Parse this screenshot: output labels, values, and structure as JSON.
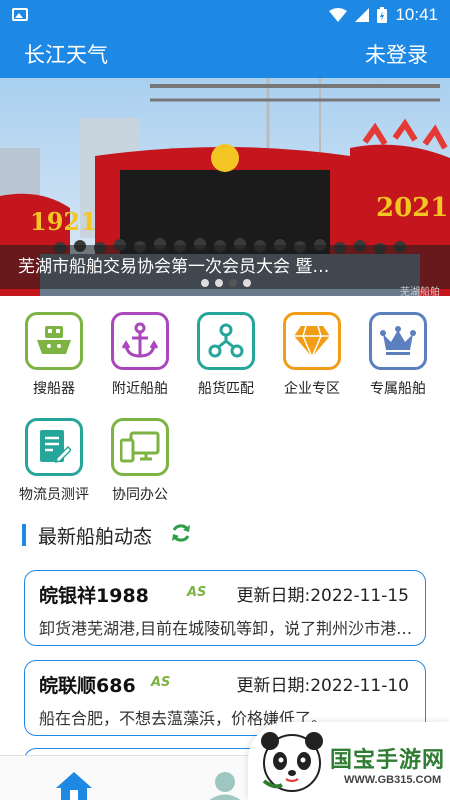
{
  "status_bar": {
    "time": "10:41",
    "icons": [
      "image-icon",
      "wifi-icon",
      "signal-icon",
      "battery-charging-icon"
    ]
  },
  "app_bar": {
    "title": "长江天气",
    "login_label": "未登录"
  },
  "banner": {
    "caption": "芜湖市船舶交易协会第一次会员大会 暨…",
    "years": [
      "1921",
      "2021"
    ],
    "watermark": "芜湖船舶",
    "slide_count": 4,
    "active_slide": 2
  },
  "features": [
    {
      "label": "搜船器",
      "icon": "ship-icon",
      "color": "#7cb342"
    },
    {
      "label": "附近船舶",
      "icon": "anchor-icon",
      "color": "#ab47bc"
    },
    {
      "label": "船货匹配",
      "icon": "network-nodes-icon",
      "color": "#26a69a"
    },
    {
      "label": "企业专区",
      "icon": "diamond-icon",
      "color": "#f29d16"
    },
    {
      "label": "专属船舶",
      "icon": "crown-icon",
      "color": "#5c7fbf"
    },
    {
      "label": "物流员测评",
      "icon": "document-edit-icon",
      "color": "#26a69a"
    },
    {
      "label": "协同办公",
      "icon": "devices-icon",
      "color": "#7cb342"
    }
  ],
  "section": {
    "title": "最新船舶动态",
    "refresh_icon": "refresh-icon"
  },
  "ship_updates": [
    {
      "name": "皖银祥1988",
      "badge": "AS",
      "date": "更新日期:2022-11-15",
      "desc": "卸货港芜湖港,目前在城陵矶等卸，说了荆州沙市港卸货"
    },
    {
      "name": "皖联顺686",
      "badge": "AS",
      "date": "更新日期:2022-11-10",
      "desc": "船在合肥，不想去蕰藻浜，价格嫌低了。"
    }
  ],
  "bottom_nav": {
    "items": [
      {
        "icon": "home-icon"
      },
      {
        "icon": "user-icon"
      }
    ]
  },
  "promo": {
    "brand": "国宝手游网",
    "domain": "WWW.GB315.COM",
    "icon": "panda-icon"
  },
  "colors": {
    "primary": "#1e88e5",
    "accent_green": "#2e9e48"
  }
}
